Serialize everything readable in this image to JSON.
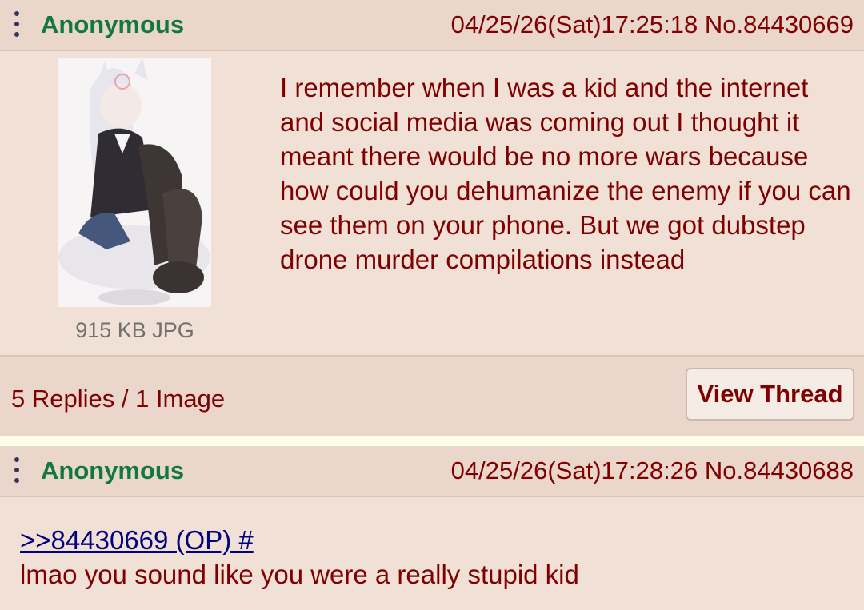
{
  "op": {
    "name": "Anonymous",
    "datetime": "04/25/26(Sat)17:25:18",
    "post_number": "No.84430669",
    "file_info": "915 KB JPG",
    "body": "I remember when I was a kid and the internet and social media was coming out I thought it meant there would be no more wars because how could you dehumanize the enemy if you can see them on your phone. But we got dubstep drone murder compilations instead",
    "replies_summary": "5 Replies / 1 Image",
    "view_thread_label": "View Thread"
  },
  "reply": {
    "name": "Anonymous",
    "datetime": "04/25/26(Sat)17:28:26",
    "post_number": "No.84430688",
    "quote_link": ">>84430669 (OP) #",
    "body": "lmao you sound like you were a really stupid kid"
  },
  "colors": {
    "name": "#117743",
    "text": "#800000",
    "quote_link": "#000080",
    "post_bg": "#f0e0d6",
    "header_bg": "#ead6ca",
    "page_bg": "#fdfde9"
  }
}
